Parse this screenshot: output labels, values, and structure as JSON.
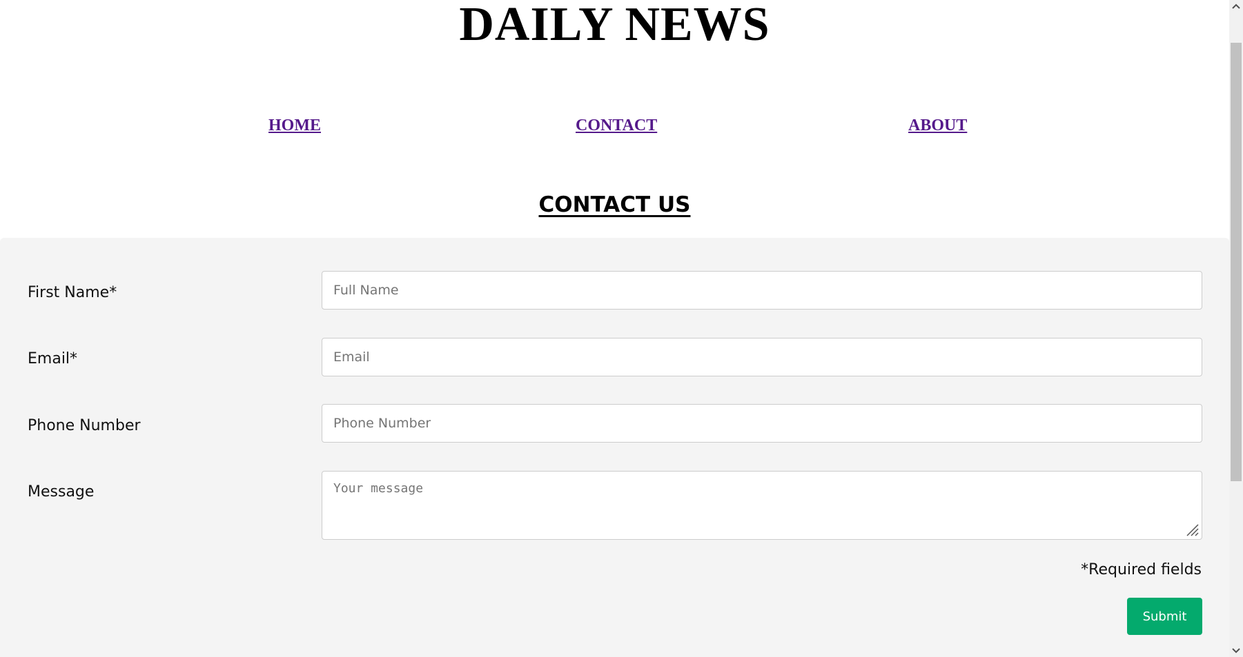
{
  "site": {
    "title": "DAILY NEWS"
  },
  "nav": {
    "items": [
      {
        "label": "HOME"
      },
      {
        "label": "CONTACT"
      },
      {
        "label": "ABOUT"
      }
    ],
    "link_color": "#551a8b"
  },
  "page": {
    "heading": "CONTACT US"
  },
  "form": {
    "panel_color": "#f4f4f4",
    "fields": {
      "first_name": {
        "label": "First Name*",
        "placeholder": "Full Name",
        "value": ""
      },
      "email": {
        "label": "Email*",
        "placeholder": "Email",
        "value": ""
      },
      "phone": {
        "label": "Phone Number",
        "placeholder": "Phone Number",
        "value": ""
      },
      "message": {
        "label": "Message",
        "placeholder": "Your message",
        "value": ""
      }
    },
    "required_note": "*Required fields",
    "submit_label": "Submit",
    "submit_color": "#04aa6d"
  },
  "icons": {
    "scroll_up": "chevron-up-icon",
    "scroll_down": "chevron-down-icon",
    "resize": "resize-grip-icon"
  }
}
